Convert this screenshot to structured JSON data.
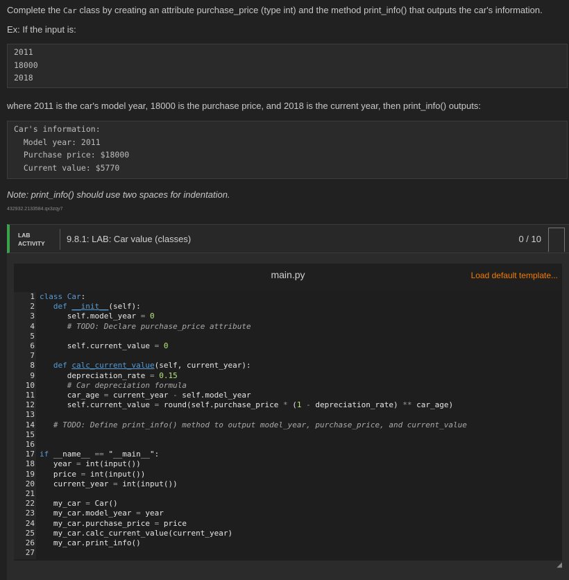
{
  "intro": {
    "line1_pre": "Complete the ",
    "line1_code": "Car",
    "line1_post": " class by creating an attribute purchase_price (type int) and the method print_info() that outputs the car's information.",
    "ex_label": "Ex: If the input is:"
  },
  "input_example": [
    "2011",
    "18000",
    "2018"
  ],
  "where_text": "where 2011 is the car's model year, 18000 is the purchase price, and 2018 is the current year, then print_info() outputs:",
  "output_example": [
    "Car's information:",
    "  Model year: 2011",
    "  Purchase price: $18000",
    "  Current value: $5770"
  ],
  "note": "Note: print_info() should use two spaces for indentation.",
  "tracking_id": "432932.2133584.qx3zqy7",
  "lab": {
    "tag_line1": "LAB",
    "tag_line2": "ACTIVITY",
    "title": "9.8.1: LAB: Car value (classes)",
    "score": "0 / 10"
  },
  "editor": {
    "filename": "main.py",
    "load_template": "Load default template...",
    "line_numbers": [
      "1",
      "2",
      "3",
      "4",
      "5",
      "6",
      "7",
      "8",
      "9",
      "10",
      "11",
      "12",
      "13",
      "14",
      "15",
      "16",
      "17",
      "18",
      "19",
      "20",
      "21",
      "22",
      "23",
      "24",
      "25",
      "26",
      "27"
    ]
  },
  "colors": {
    "accent_orange": "#f57c00",
    "lab_green": "#3aa34a",
    "keyword_blue": "#569cd6",
    "number_green": "#b5e87a"
  }
}
